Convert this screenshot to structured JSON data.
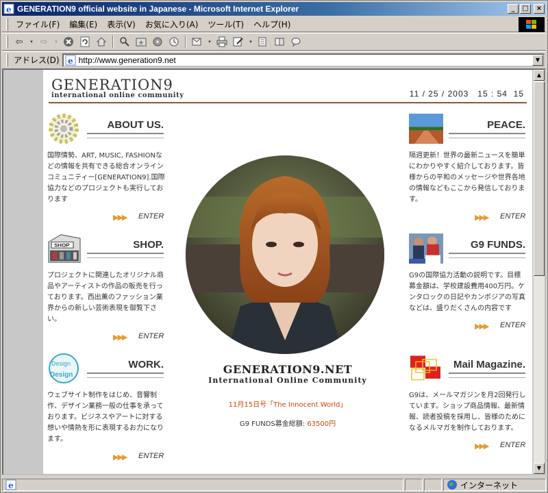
{
  "window": {
    "title": "GENERATION9 official website in Japanese - Microsoft Internet Explorer",
    "minimize": "_",
    "maximize": "□",
    "close": "×"
  },
  "menu": [
    "ファイル(F)",
    "編集(E)",
    "表示(V)",
    "お気に入り(A)",
    "ツール(T)",
    "ヘルプ(H)"
  ],
  "address": {
    "label": "アドレス(D)",
    "url": "http://www.generation9.net"
  },
  "status": {
    "text": "",
    "zone": "インターネット"
  },
  "page": {
    "logo_main": "GENERATION9",
    "logo_sub": "international online community",
    "datetime": "11 / 25 / 2003   15 : 54  15",
    "enter_label": "ENTER",
    "sections": {
      "about": {
        "title": "ABOUT US.",
        "body": "国際情勢、ART, MUSIC, FASHIONなどの情報を共有できる総合オンラインコミュニティー[GENERATION9].国際協力などのプロジェクトも実行しております"
      },
      "shop": {
        "title": "SHOP.",
        "thumb_label": "SHOP",
        "body": "プロジェクトに関連したオリジナル商品やアーティストの作品の販売を行っております。西出薫のファッション業界からの新しい芸術表現を御覧下さい。"
      },
      "work": {
        "title": "WORK.",
        "thumb_label_1": "Design",
        "thumb_label_2": "Design",
        "body": "ウェブサイト制作をはじめ、音響制作、デザイン業務一般の仕事を承っております。ビジネスやアートに対する想いや情熱を形に表現するお力になります。"
      },
      "peace": {
        "title": "PEACE.",
        "body": "隔週更新！世界の最新ニュースを簡単にわかりやすく紹介しております。皆様からの平和のメッセージや世界各地の情報などもここから発信しております。"
      },
      "funds": {
        "title": "G9 FUNDS.",
        "body": "G9の国際協力活動の説明です。目標募金額は、学校建設費用400万円。ケンタロックの日記やカンボジアの写真などは、盛りだくさんの内容です"
      },
      "mail": {
        "title": "Mail Magazine.",
        "body": "G9は、メールマガジンを月2回発行しています。ショップ商品情報、最新情報、読者投稿を採用し、皆様のためになるメルマガを制作しております。"
      }
    },
    "center_main": "GENERATION9.NET",
    "center_sub": "International Online Community",
    "issue": "11月15日号「The Innocent World」",
    "funds_label": "G9 FUNDS募金総額: ",
    "funds_amount": "63500円"
  },
  "colors": {
    "accent": "#cc4400",
    "header_rule": "#8a5a2a",
    "enter_arrows": "#e89a30"
  }
}
